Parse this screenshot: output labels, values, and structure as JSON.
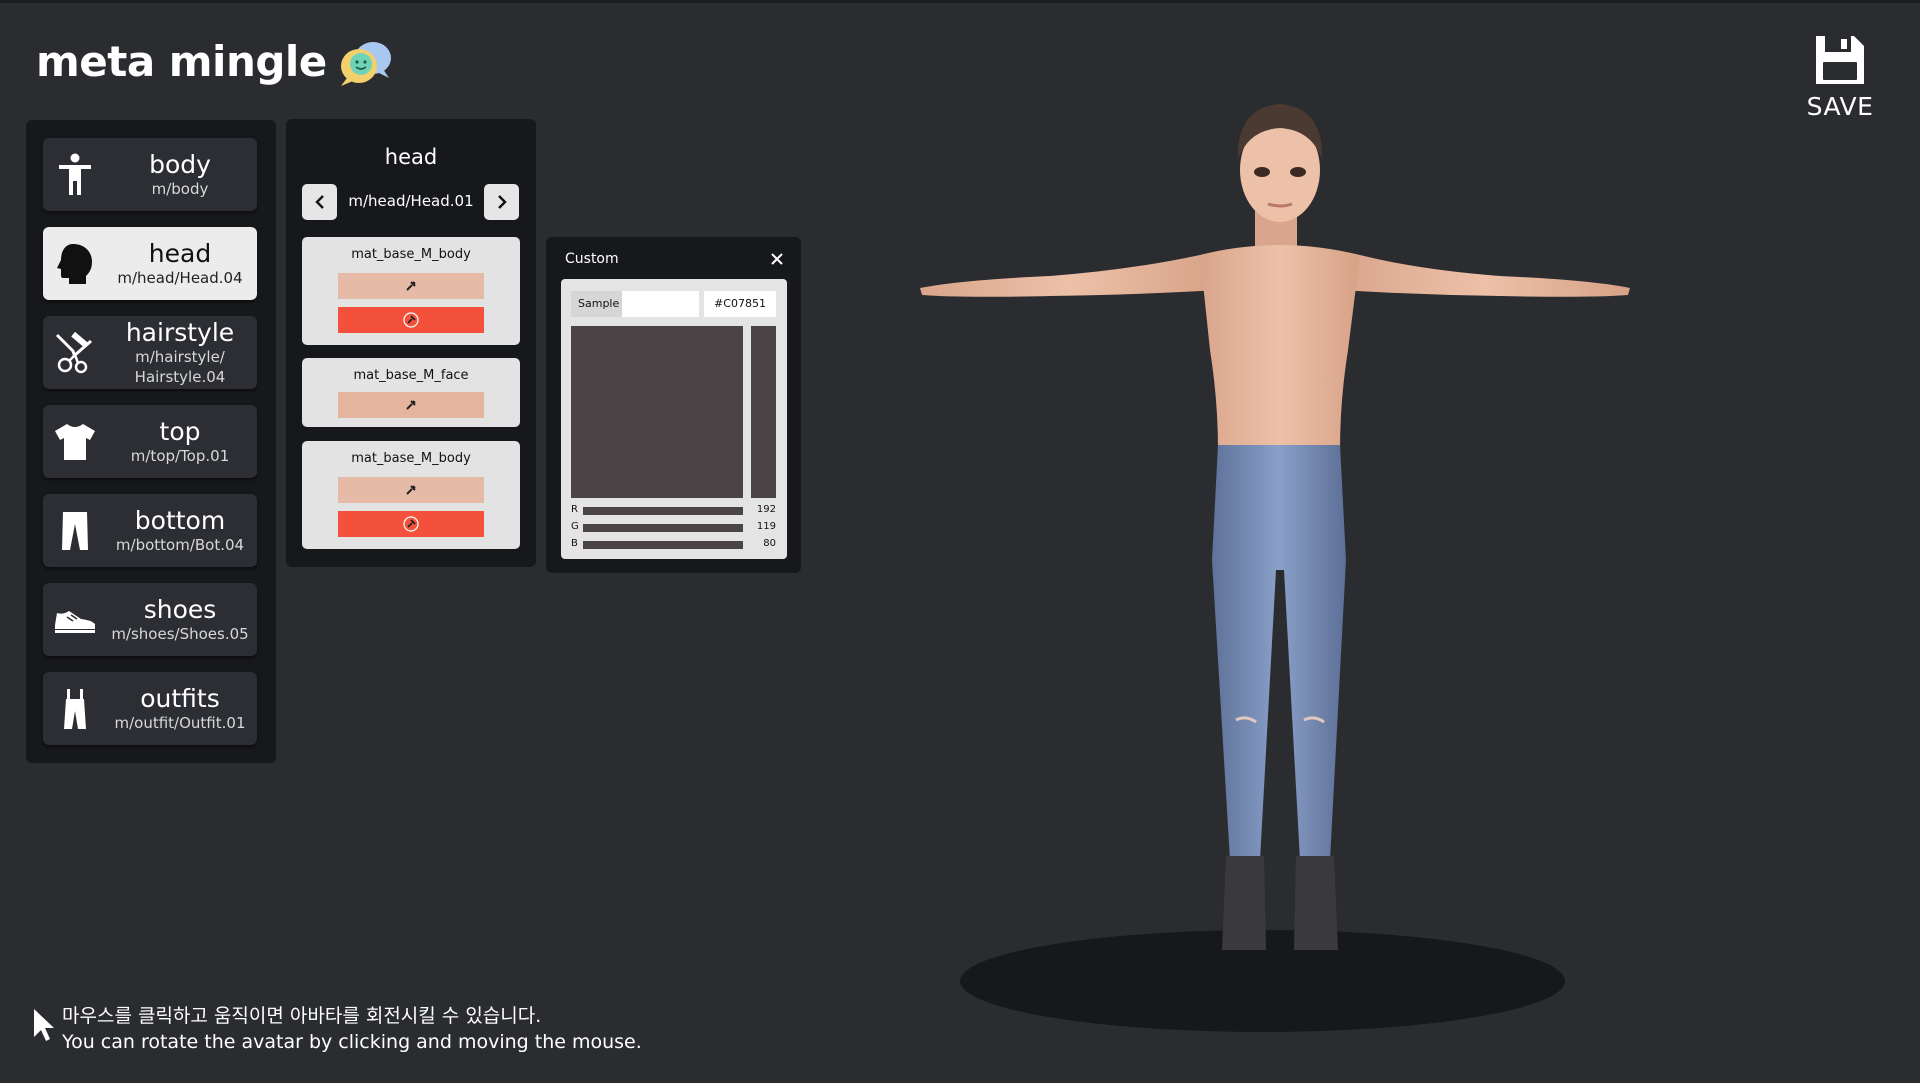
{
  "app": {
    "title": "meta mingle",
    "logo_icon": "chat-bubbles-icon",
    "save_label": "SAVE"
  },
  "categories": [
    {
      "id": "body",
      "title": "body",
      "path": "m/body",
      "icon": "person-icon",
      "active": false
    },
    {
      "id": "head",
      "title": "head",
      "path": "m/head/Head.04",
      "icon": "head-icon",
      "active": true
    },
    {
      "id": "hairstyle",
      "title": "hairstyle",
      "path_line1": "m/hairstyle/",
      "path_line2": "Hairstyle.04",
      "icon": "scissors-icon",
      "active": false
    },
    {
      "id": "top",
      "title": "top",
      "path": "m/top/Top.01",
      "icon": "tshirt-icon",
      "active": false
    },
    {
      "id": "bottom",
      "title": "bottom",
      "path": "m/bottom/Bot.04",
      "icon": "pants-icon",
      "active": false
    },
    {
      "id": "shoes",
      "title": "shoes",
      "path": "m/shoes/Shoes.05",
      "icon": "shoe-icon",
      "active": false
    },
    {
      "id": "outfits",
      "title": "outfits",
      "path": "m/outfit/Outfit.01",
      "icon": "overalls-icon",
      "active": false
    }
  ],
  "detail": {
    "title": "head",
    "current": "m/head/Head.01",
    "materials": [
      {
        "name": "mat_base_M_body",
        "swatches": [
          "#e5bba7",
          "#f4513c"
        ]
      },
      {
        "name": "mat_base_M_face",
        "swatches": [
          "#e5b5a0"
        ]
      },
      {
        "name": "mat_base_M_body",
        "swatches": [
          "#e5bba7",
          "#f4513c"
        ]
      }
    ]
  },
  "custom": {
    "title": "Custom",
    "sample_label": "Sample",
    "hex": "#C07851",
    "r_label": "R",
    "r": "192",
    "g_label": "G",
    "g": "119",
    "b_label": "B",
    "b": "80"
  },
  "hint": {
    "ko": "마우스를 클릭하고 움직이면 아바타를 회전시킬 수 있습니다.",
    "en": "You can rotate the avatar by clicking and moving the mouse."
  },
  "colors": {
    "background": "#2a2c30",
    "panel": "#17181b",
    "swatch_skin": "#e5bba7",
    "swatch_red": "#f4513c"
  }
}
